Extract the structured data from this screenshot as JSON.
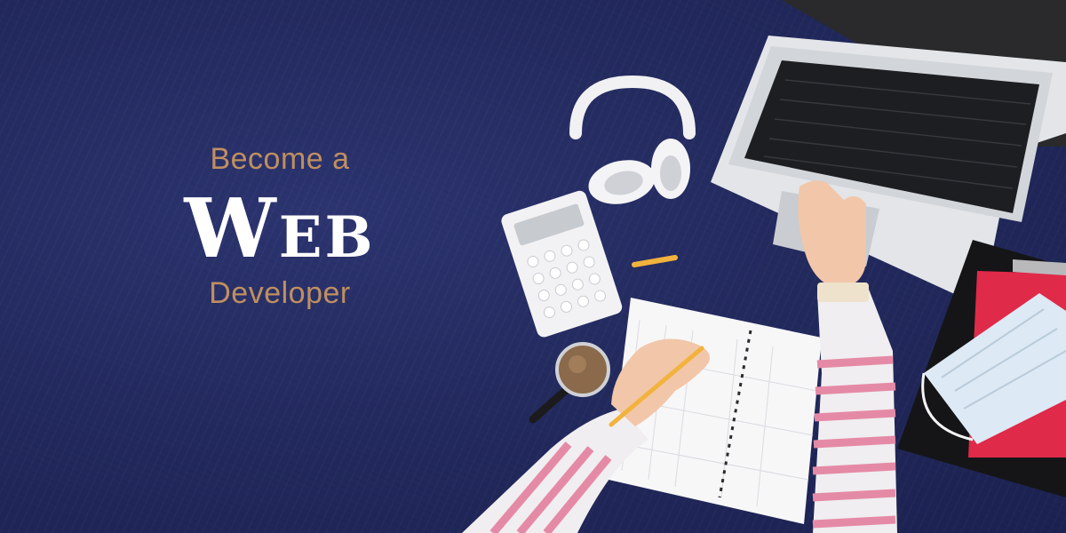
{
  "headline": {
    "line1": "Become a",
    "line2": "Web",
    "line3": "Developer"
  },
  "colors": {
    "background": "#232a5e",
    "accent": "#c08f5f",
    "title": "#ffffff"
  },
  "illustration": {
    "items": [
      "laptop",
      "headphones",
      "calculator",
      "pencil",
      "notebook",
      "magnifying-glass",
      "hands",
      "notebooks-stack",
      "face-mask"
    ]
  }
}
